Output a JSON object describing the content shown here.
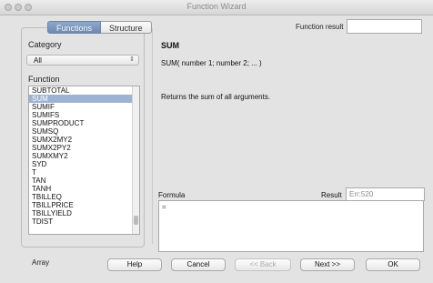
{
  "window": {
    "title": "Function Wizard"
  },
  "tabs": [
    {
      "label": "Functions"
    },
    {
      "label": "Structure"
    }
  ],
  "function_result": {
    "label": "Function result",
    "value": ""
  },
  "category": {
    "label": "Category",
    "selected": "All"
  },
  "function_list": {
    "label": "Function",
    "items": [
      "SUBTOTAL",
      "SUM",
      "SUMIF",
      "SUMIFS",
      "SUMPRODUCT",
      "SUMSQ",
      "SUMX2MY2",
      "SUMX2PY2",
      "SUMXMY2",
      "SYD",
      "T",
      "TAN",
      "TANH",
      "TBILLEQ",
      "TBILLPRICE",
      "TBILLYIELD",
      "TDIST"
    ],
    "selected": "SUM"
  },
  "detail": {
    "name": "SUM",
    "signature": "SUM( number 1; number 2; ... )",
    "description": "Returns the sum of all arguments."
  },
  "formula": {
    "label": "Formula",
    "value": "="
  },
  "result": {
    "label": "Result",
    "value": "Err:520"
  },
  "options": {
    "array_label": "Array"
  },
  "buttons": {
    "help": "Help",
    "cancel": "Cancel",
    "back": "<< Back",
    "next": "Next >>",
    "ok": "OK"
  }
}
